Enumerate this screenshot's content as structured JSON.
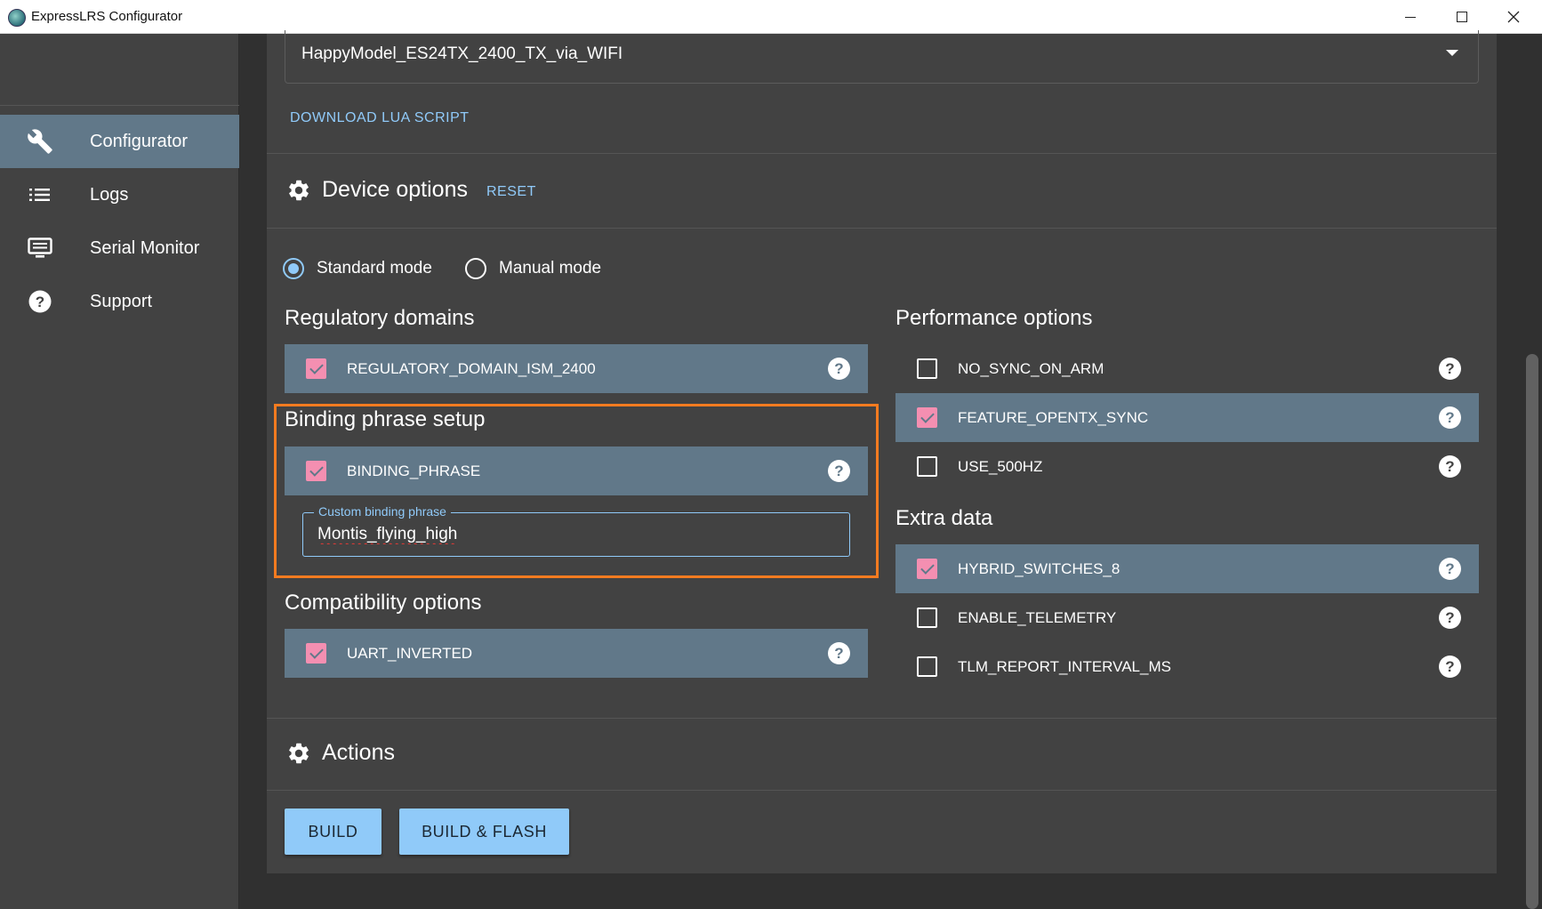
{
  "window": {
    "title": "ExpressLRS Configurator",
    "controls": {
      "minimize": "minimize-icon",
      "maximize": "maximize-icon",
      "close": "close-icon"
    }
  },
  "sidebar": {
    "items": [
      {
        "label": "Configurator",
        "icon": "wrench-icon",
        "active": true
      },
      {
        "label": "Logs",
        "icon": "list-icon",
        "active": false
      },
      {
        "label": "Serial Monitor",
        "icon": "monitor-icon",
        "active": false
      },
      {
        "label": "Support",
        "icon": "help-circle-icon",
        "active": false
      }
    ]
  },
  "target": {
    "selected": "HappyModel_ES24TX_2400_TX_via_WIFI",
    "download_lua_label": "DOWNLOAD LUA SCRIPT"
  },
  "device_options": {
    "title": "Device options",
    "reset_label": "RESET",
    "modes": [
      {
        "label": "Standard mode",
        "checked": true
      },
      {
        "label": "Manual mode",
        "checked": false
      }
    ],
    "regulatory": {
      "title": "Regulatory domains",
      "options": [
        {
          "label": "REGULATORY_DOMAIN_ISM_2400",
          "checked": true
        }
      ]
    },
    "binding": {
      "title": "Binding phrase setup",
      "options": [
        {
          "label": "BINDING_PHRASE",
          "checked": true
        }
      ],
      "field_label": "Custom binding phrase",
      "field_value": "Montis_flying_high"
    },
    "compatibility": {
      "title": "Compatibility options",
      "options": [
        {
          "label": "UART_INVERTED",
          "checked": true
        }
      ]
    },
    "performance": {
      "title": "Performance options",
      "options": [
        {
          "label": "NO_SYNC_ON_ARM",
          "checked": false
        },
        {
          "label": "FEATURE_OPENTX_SYNC",
          "checked": true
        },
        {
          "label": "USE_500HZ",
          "checked": false
        }
      ]
    },
    "extra": {
      "title": "Extra data",
      "options": [
        {
          "label": "HYBRID_SWITCHES_8",
          "checked": true
        },
        {
          "label": "ENABLE_TELEMETRY",
          "checked": false
        },
        {
          "label": "TLM_REPORT_INTERVAL_MS",
          "checked": false
        }
      ]
    },
    "help_glyph": "?"
  },
  "actions": {
    "title": "Actions",
    "build_label": "BUILD",
    "build_flash_label": "BUILD & FLASH"
  },
  "colors": {
    "accent": "#90caf9",
    "checkbox_checked": "#f48fb1",
    "row_highlight": "#617889",
    "annotation_box": "#f47b20"
  }
}
